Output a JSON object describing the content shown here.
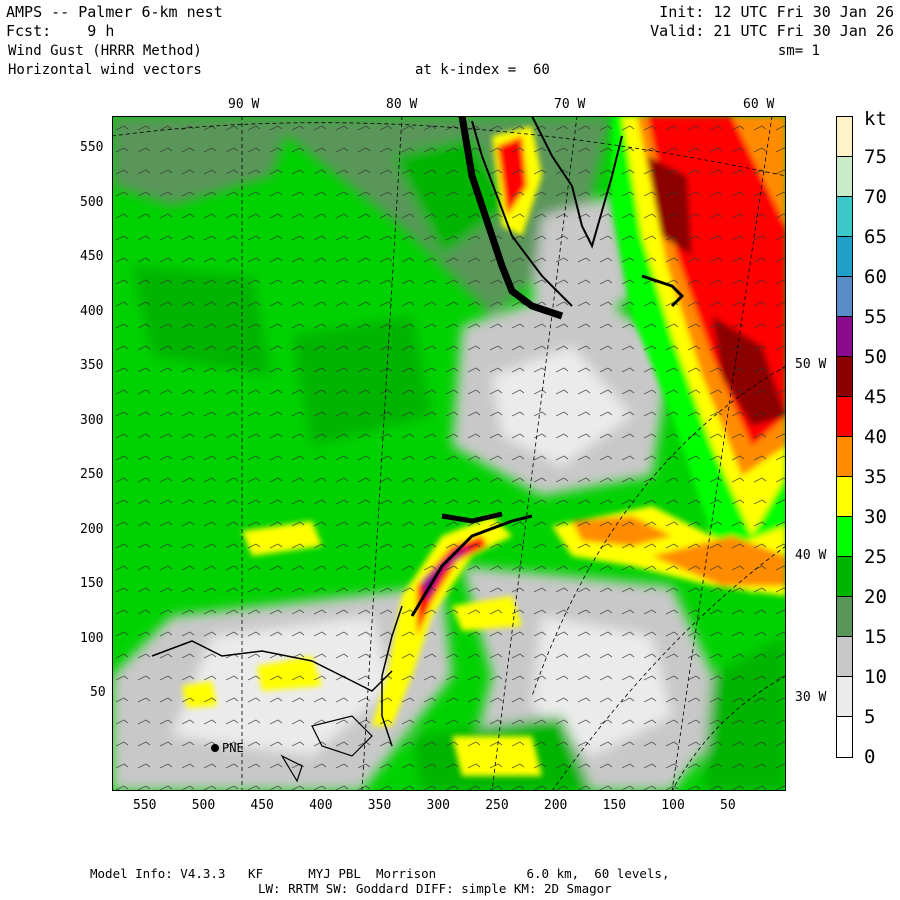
{
  "header": {
    "line1_left": "AMPS -- Palmer 6-km nest",
    "line2_left": "Fcst:    9 h",
    "line3_left": "Wind Gust (HRRR Method)",
    "line4_left": "Horizontal wind vectors",
    "init": "Init: 12 UTC Fri 30 Jan 26",
    "valid": "Valid: 21 UTC Fri 30 Jan 26",
    "sm": "sm= 1",
    "k_index": "at k-index =  60"
  },
  "axes": {
    "y_ticks": [
      "550",
      "500",
      "450",
      "400",
      "350",
      "300",
      "250",
      "200",
      "150",
      "100",
      "50"
    ],
    "x_ticks": [
      "550",
      "500",
      "450",
      "400",
      "350",
      "300",
      "250",
      "200",
      "150",
      "100",
      "50"
    ],
    "lon_top": [
      "90 W",
      "80 W",
      "70 W",
      "60 W"
    ],
    "lon_right": [
      "50 W",
      "40 W",
      "30 W"
    ]
  },
  "station": {
    "label": "PNE"
  },
  "colorbar": {
    "unit": "kt",
    "labels": [
      "75",
      "70",
      "65",
      "60",
      "55",
      "50",
      "45",
      "40",
      "35",
      "30",
      "25",
      "20",
      "15",
      "10",
      "5",
      "0"
    ],
    "colors": [
      "#fff2c8",
      "#c8ecc8",
      "#3cc8c8",
      "#1ea0c8",
      "#5a8cc8",
      "#8c0a8c",
      "#8c0000",
      "#ff0000",
      "#ff8c00",
      "#ffff00",
      "#00ff00",
      "#00b400",
      "#5a965a",
      "#c8c8c8",
      "#ebebeb",
      "#ffffff"
    ]
  },
  "footer": {
    "line1": "Model Info: V4.3.3   KF      MYJ PBL  Morrison            6.0 km,  60 levels,",
    "line2": "LW: RRTM SW: Goddard DIFF: simple KM: 2D Smagor"
  }
}
